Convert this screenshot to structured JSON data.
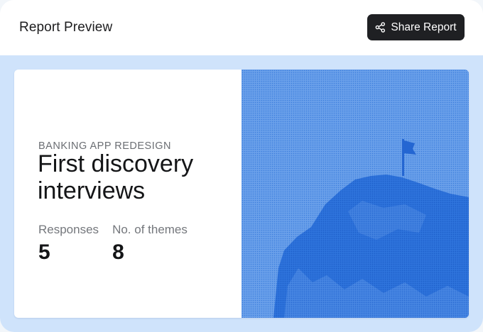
{
  "header": {
    "title": "Report Preview",
    "share_label": "Share Report",
    "share_icon": "share-icon"
  },
  "report": {
    "project": "BANKING APP REDESIGN",
    "title_line1": "First discovery",
    "title_line2": "interviews",
    "stats": [
      {
        "label": "Responses",
        "value": "5"
      },
      {
        "label": "No. of themes",
        "value": "8"
      }
    ]
  },
  "colors": {
    "panel_bg": "#cfe3fb",
    "button_bg": "#1f2023",
    "art_blue": "#5f97e5",
    "art_dark": "#2a6fd9"
  }
}
